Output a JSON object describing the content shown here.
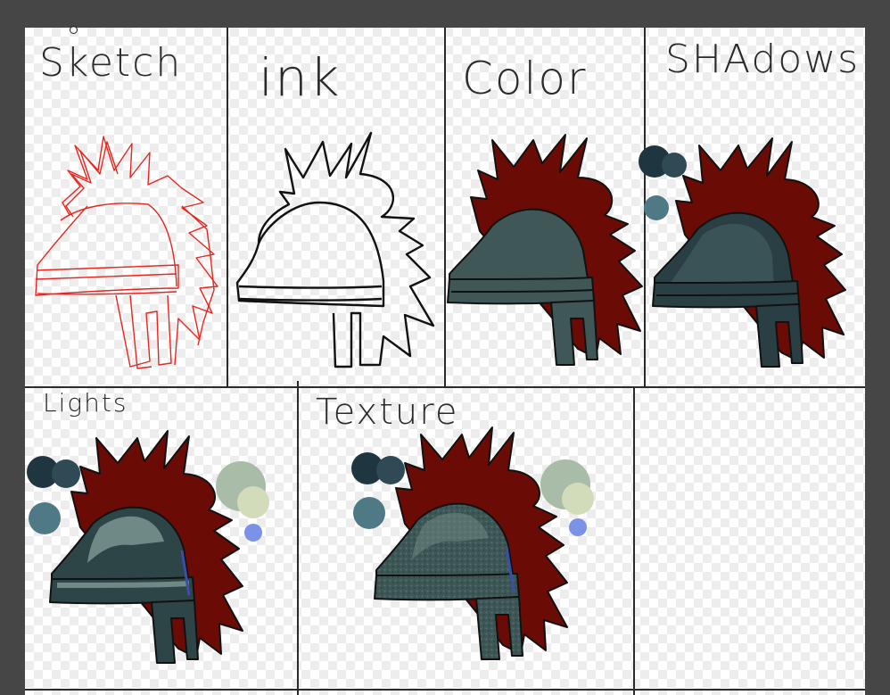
{
  "panels": [
    {
      "id": "sketch",
      "label": "Sketch"
    },
    {
      "id": "ink",
      "label": "ink"
    },
    {
      "id": "color",
      "label": "Color"
    },
    {
      "id": "shadows",
      "label": "SHAdows"
    },
    {
      "id": "lights",
      "label": "Lights"
    },
    {
      "id": "texture",
      "label": "Texture"
    }
  ],
  "colors": {
    "app_background": "#464646",
    "hair_red": "#6a0c05",
    "helmet_base": "#3f5757",
    "helmet_shadow": "#2a3f43",
    "helmet_light": "#6f8a86",
    "sketch_line": "#e8261f",
    "ink_line": "#111111",
    "palette_dark": "#1f3640",
    "palette_mid": "#2f4a54",
    "palette_steel": "#4f7985",
    "palette_sage": "#a9bca8",
    "palette_pale": "#d3dcba",
    "palette_blue": "#7c92e6"
  }
}
